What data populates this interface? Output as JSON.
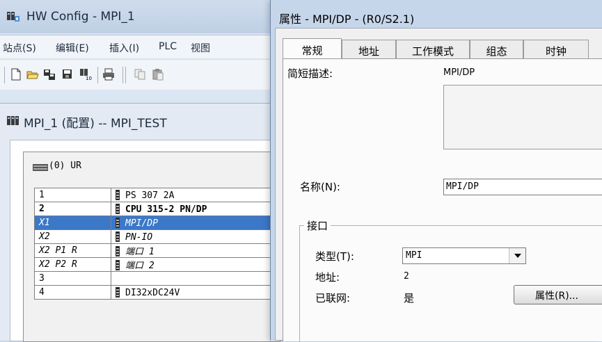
{
  "background_window": {
    "title": "HW Config - MPI_1",
    "menu": [
      "站点(S)",
      "编辑(E)",
      "插入(I)",
      "PLC",
      "视图"
    ],
    "toolbar_icons": [
      "new-icon",
      "open-icon",
      "save-as-icon",
      "save-icon",
      "download-icon",
      "print-icon",
      "copy-icon",
      "paste-icon"
    ],
    "config_window": {
      "title": "MPI_1 (配置) -- MPI_TEST",
      "rack_label": "(0) UR",
      "rows": [
        {
          "slot": "1",
          "module": "PS 307 2A",
          "style": "normal",
          "icon": true
        },
        {
          "slot": "2",
          "module": "CPU 315-2 PN/DP",
          "style": "bold",
          "icon": true
        },
        {
          "slot": "X1",
          "module": "MPI/DP",
          "style": "italic",
          "icon": true,
          "selected": true
        },
        {
          "slot": "X2",
          "module": "PN-IO",
          "style": "italic",
          "icon": true
        },
        {
          "slot": "X2 P1 R",
          "module": "端口 1",
          "style": "italic",
          "icon": true
        },
        {
          "slot": "X2 P2 R",
          "module": "端口 2",
          "style": "italic",
          "icon": true
        },
        {
          "slot": "3",
          "module": "",
          "style": "normal",
          "icon": false
        },
        {
          "slot": "4",
          "module": "DI32xDC24V",
          "style": "normal",
          "icon": true
        }
      ]
    }
  },
  "dialog": {
    "title": "属性 - MPI/DP - (R0/S2.1)",
    "tabs": [
      "常规",
      "地址",
      "工作模式",
      "组态",
      "时钟"
    ],
    "active_tab": "常规",
    "short_desc_label": "简短描述:",
    "short_desc_value": "MPI/DP",
    "name_label": "名称(N):",
    "name_value": "MPI/DP",
    "interface": {
      "legend": "接口",
      "type_label": "类型(T):",
      "type_value": "MPI",
      "address_label": "地址:",
      "address_value": "2",
      "networked_label": "已联网:",
      "networked_value": "是",
      "properties_button": "属性(R)..."
    }
  }
}
